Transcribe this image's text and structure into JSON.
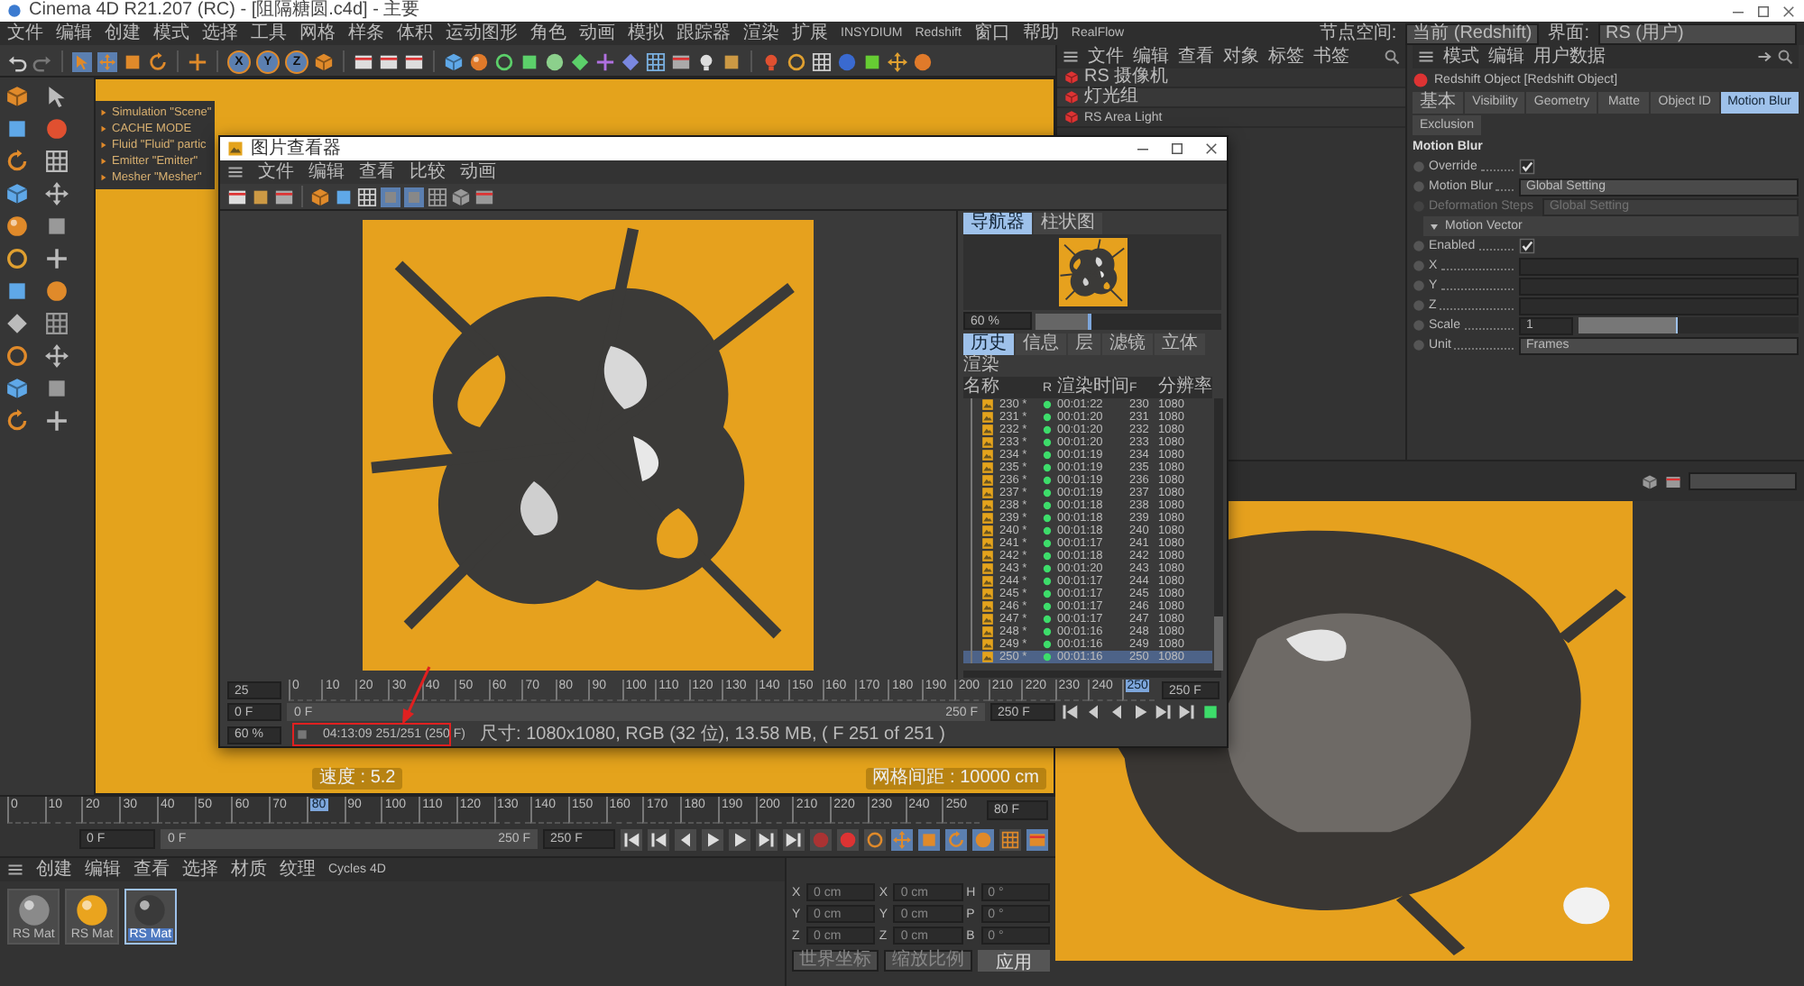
{
  "window": {
    "title": "Cinema 4D R21.207 (RC) - [阻隔糖圆.c4d] - 主要"
  },
  "menu": [
    "文件",
    "编辑",
    "创建",
    "模式",
    "选择",
    "工具",
    "网格",
    "样条",
    "体积",
    "运动图形",
    "角色",
    "动画",
    "模拟",
    "跟踪器",
    "渲染",
    "扩展",
    "INSYDIUM",
    "Redshift",
    "窗口",
    "帮助",
    "RealFlow"
  ],
  "node_space": {
    "label": "节点空间:",
    "value": "当前 (Redshift)"
  },
  "layout": {
    "label": "界面:",
    "value": "RS (用户)"
  },
  "toolbar": {
    "axes": [
      "X",
      "Y",
      "Z"
    ]
  },
  "simulation_panel": {
    "items": [
      "Simulation \"Scene\"",
      "CACHE MODE",
      "Fluid \"Fluid\" partic",
      "Emitter \"Emitter\"",
      "Mesher \"Mesher\""
    ]
  },
  "viewport": {
    "speed": "速度 : 5.2",
    "grid_spacing": "网格间距 : 10000 cm"
  },
  "object_manager": {
    "menu": [
      "文件",
      "编辑",
      "查看",
      "对象",
      "标签",
      "书签"
    ],
    "objects": [
      "RS 摄像机",
      "灯光组",
      "RS Area Light"
    ]
  },
  "attributes": {
    "menu": [
      "模式",
      "编辑",
      "用户数据"
    ],
    "object": "Redshift Object [Redshift Object]",
    "tabs": [
      {
        "label": "基本",
        "selected": false
      },
      {
        "label": "Visibility",
        "selected": false
      },
      {
        "label": "Geometry",
        "selected": false
      },
      {
        "label": "Matte",
        "selected": false
      },
      {
        "label": "Object ID",
        "selected": false
      },
      {
        "label": "Motion Blur",
        "selected": true
      },
      {
        "label": "Exclusion",
        "selected": false
      }
    ],
    "section": "Motion Blur",
    "params": [
      {
        "kind": "check",
        "label": "Override",
        "checked": true,
        "disabled": false
      },
      {
        "kind": "select",
        "label": "Motion Blur",
        "value": "Global Setting",
        "disabled": false
      },
      {
        "kind": "select",
        "label": "Deformation Steps",
        "value": "Global Setting",
        "disabled": true
      },
      {
        "kind": "group",
        "label": "Motion Vector",
        "expanded": true
      },
      {
        "kind": "check",
        "label": "Enabled",
        "checked": true,
        "disabled": false
      },
      {
        "kind": "field",
        "label": "X"
      },
      {
        "kind": "field",
        "label": "Y"
      },
      {
        "kind": "field",
        "label": "Z"
      },
      {
        "kind": "slider",
        "label": "Scale",
        "value": "1",
        "level": 0.45
      },
      {
        "kind": "select",
        "label": "Unit",
        "value": "Frames",
        "disabled": false
      }
    ]
  },
  "picture_viewer": {
    "title": "图片查看器",
    "menu": [
      "文件",
      "编辑",
      "查看",
      "比较",
      "动画"
    ],
    "panel_tabs": [
      {
        "label": "导航器",
        "selected": true
      },
      {
        "label": "柱状图",
        "selected": false
      }
    ],
    "zoom": {
      "value": "60 %",
      "level": 0.3
    },
    "info_tabs": [
      {
        "label": "历史",
        "selected": true
      },
      {
        "label": "信息",
        "selected": false
      },
      {
        "label": "层",
        "selected": false
      },
      {
        "label": "滤镜",
        "selected": false
      },
      {
        "label": "立体",
        "selected": false
      }
    ],
    "list_title": "渲染",
    "columns": [
      "名称",
      "R",
      "渲染时间",
      "F",
      "分辨率"
    ],
    "renders": [
      {
        "name": "230 *",
        "time": "00:01:22",
        "frame": "230",
        "resolution": "1080",
        "selected": false
      },
      {
        "name": "231 *",
        "time": "00:01:20",
        "frame": "231",
        "resolution": "1080",
        "selected": false
      },
      {
        "name": "232 *",
        "time": "00:01:20",
        "frame": "232",
        "resolution": "1080",
        "selected": false
      },
      {
        "name": "233 *",
        "time": "00:01:20",
        "frame": "233",
        "resolution": "1080",
        "selected": false
      },
      {
        "name": "234 *",
        "time": "00:01:19",
        "frame": "234",
        "resolution": "1080",
        "selected": false
      },
      {
        "name": "235 *",
        "time": "00:01:19",
        "frame": "235",
        "resolution": "1080",
        "selected": false
      },
      {
        "name": "236 *",
        "time": "00:01:19",
        "frame": "236",
        "resolution": "1080",
        "selected": false
      },
      {
        "name": "237 *",
        "time": "00:01:19",
        "frame": "237",
        "resolution": "1080",
        "selected": false
      },
      {
        "name": "238 *",
        "time": "00:01:18",
        "frame": "238",
        "resolution": "1080",
        "selected": false
      },
      {
        "name": "239 *",
        "time": "00:01:18",
        "frame": "239",
        "resolution": "1080",
        "selected": false
      },
      {
        "name": "240 *",
        "time": "00:01:18",
        "frame": "240",
        "resolution": "1080",
        "selected": false
      },
      {
        "name": "241 *",
        "time": "00:01:17",
        "frame": "241",
        "resolution": "1080",
        "selected": false
      },
      {
        "name": "242 *",
        "time": "00:01:18",
        "frame": "242",
        "resolution": "1080",
        "selected": false
      },
      {
        "name": "243 *",
        "time": "00:01:20",
        "frame": "243",
        "resolution": "1080",
        "selected": false
      },
      {
        "name": "244 *",
        "time": "00:01:17",
        "frame": "244",
        "resolution": "1080",
        "selected": false
      },
      {
        "name": "245 *",
        "time": "00:01:17",
        "frame": "245",
        "resolution": "1080",
        "selected": false
      },
      {
        "name": "246 *",
        "time": "00:01:17",
        "frame": "246",
        "resolution": "1080",
        "selected": false
      },
      {
        "name": "247 *",
        "time": "00:01:17",
        "frame": "247",
        "resolution": "1080",
        "selected": false
      },
      {
        "name": "248 *",
        "time": "00:01:16",
        "frame": "248",
        "resolution": "1080",
        "selected": false
      },
      {
        "name": "249 *",
        "time": "00:01:16",
        "frame": "249",
        "resolution": "1080",
        "selected": false
      },
      {
        "name": "250 *",
        "time": "00:01:16",
        "frame": "250",
        "resolution": "1080",
        "selected": true
      }
    ],
    "fps": "25",
    "ruler": [
      {
        "label": "0",
        "current": false
      },
      {
        "label": "10",
        "current": false
      },
      {
        "label": "20",
        "current": false
      },
      {
        "label": "30",
        "current": false
      },
      {
        "label": "40",
        "current": false
      },
      {
        "label": "50",
        "current": false
      },
      {
        "label": "60",
        "current": false
      },
      {
        "label": "70",
        "current": false
      },
      {
        "label": "80",
        "current": false
      },
      {
        "label": "90",
        "current": false
      },
      {
        "label": "100",
        "current": false
      },
      {
        "label": "110",
        "current": false
      },
      {
        "label": "120",
        "current": false
      },
      {
        "label": "130",
        "current": false
      },
      {
        "label": "140",
        "current": false
      },
      {
        "label": "150",
        "current": false
      },
      {
        "label": "160",
        "current": false
      },
      {
        "label": "170",
        "current": false
      },
      {
        "label": "180",
        "current": false
      },
      {
        "label": "190",
        "current": false
      },
      {
        "label": "200",
        "current": false
      },
      {
        "label": "210",
        "current": false
      },
      {
        "label": "220",
        "current": false
      },
      {
        "label": "230",
        "current": false
      },
      {
        "label": "240",
        "current": false
      },
      {
        "label": "250",
        "current": true
      }
    ],
    "ruler_end": "250 F",
    "frame": "0 F",
    "range_start": "0 F",
    "range_end": "250 F",
    "end": "250 F",
    "status_zoom": "60 %",
    "status_time": "04:13:09 251/251 (250 F)",
    "status_info": "尺寸: 1080x1080, RGB (32 位), 13.58 MB, ( F 251 of 251 )"
  },
  "timeline": {
    "ticks": [
      {
        "label": "0",
        "current": false
      },
      {
        "label": "10",
        "current": false
      },
      {
        "label": "20",
        "current": false
      },
      {
        "label": "30",
        "current": false
      },
      {
        "label": "40",
        "current": false
      },
      {
        "label": "50",
        "current": false
      },
      {
        "label": "60",
        "current": false
      },
      {
        "label": "70",
        "current": false
      },
      {
        "label": "80",
        "current": true
      },
      {
        "label": "90",
        "current": false
      },
      {
        "label": "100",
        "current": false
      },
      {
        "label": "110",
        "current": false
      },
      {
        "label": "120",
        "current": false
      },
      {
        "label": "130",
        "current": false
      },
      {
        "label": "140",
        "current": false
      },
      {
        "label": "150",
        "current": false
      },
      {
        "label": "160",
        "current": false
      },
      {
        "label": "170",
        "current": false
      },
      {
        "label": "180",
        "current": false
      },
      {
        "label": "190",
        "current": false
      },
      {
        "label": "200",
        "current": false
      },
      {
        "label": "210",
        "current": false
      },
      {
        "label": "220",
        "current": false
      },
      {
        "label": "230",
        "current": false
      },
      {
        "label": "240",
        "current": false
      },
      {
        "label": "250",
        "current": false
      }
    ],
    "frame": "80 F",
    "start": "0 F",
    "range_start": "0 F",
    "range_end": "250 F",
    "end": "250 F"
  },
  "materials": {
    "menu": [
      "创建",
      "编辑",
      "查看",
      "选择",
      "材质",
      "纹理",
      "Cycles 4D"
    ],
    "items": [
      {
        "name": "RS Mat",
        "kind": "chrome",
        "selected": false
      },
      {
        "name": "RS Mat",
        "kind": "gold",
        "selected": false
      },
      {
        "name": "RS Mat",
        "kind": "dark",
        "selected": true
      }
    ]
  },
  "coordinates": {
    "rows": [
      {
        "p_axis": "X",
        "p": "0 cm",
        "s_axis": "X",
        "s": "0 cm",
        "r_axis": "H",
        "r": "0 °"
      },
      {
        "p_axis": "Y",
        "p": "0 cm",
        "s_axis": "Y",
        "s": "0 cm",
        "r_axis": "P",
        "r": "0 °"
      },
      {
        "p_axis": "Z",
        "p": "0 cm",
        "s_axis": "Z",
        "s": "0 cm",
        "r_axis": "B",
        "r": "0 °"
      }
    ],
    "space": "世界坐标",
    "scale": "缩放比例",
    "apply": "应用"
  }
}
